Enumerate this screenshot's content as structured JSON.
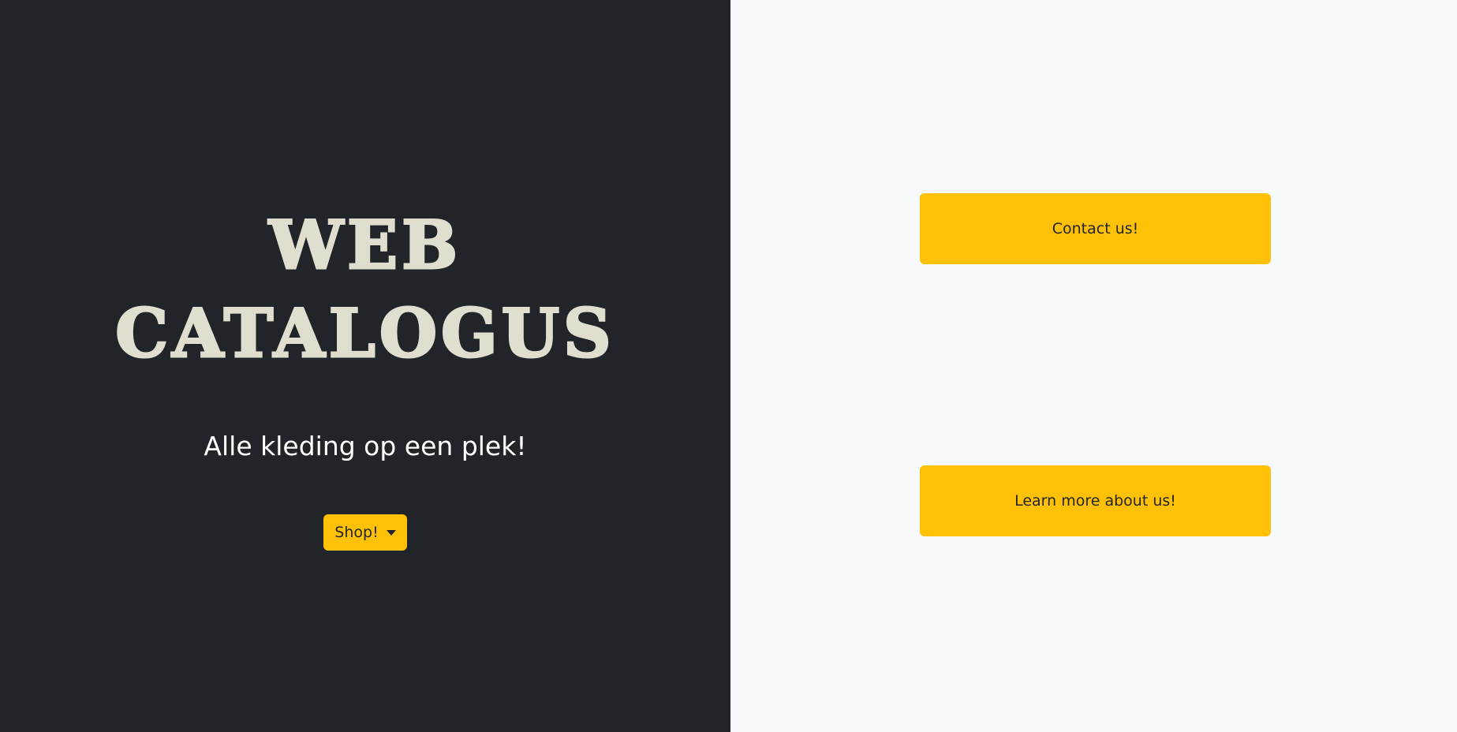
{
  "hero": {
    "title_line1": "WEB",
    "title_line2": "CATALOGUS",
    "tagline": "Alle kleding op een plek!",
    "shop_button_label": "Shop!",
    "shop_button_icon": "caret-down-icon"
  },
  "actions": {
    "contact_label": "Contact us!",
    "about_label": "Learn more about us!"
  },
  "colors": {
    "dark_background": "#212529",
    "light_background": "#f8f9fa",
    "accent": "#ffc107",
    "title_color": "#e0dfcf",
    "tagline_color": "#ffffff",
    "button_text": "#212529"
  }
}
